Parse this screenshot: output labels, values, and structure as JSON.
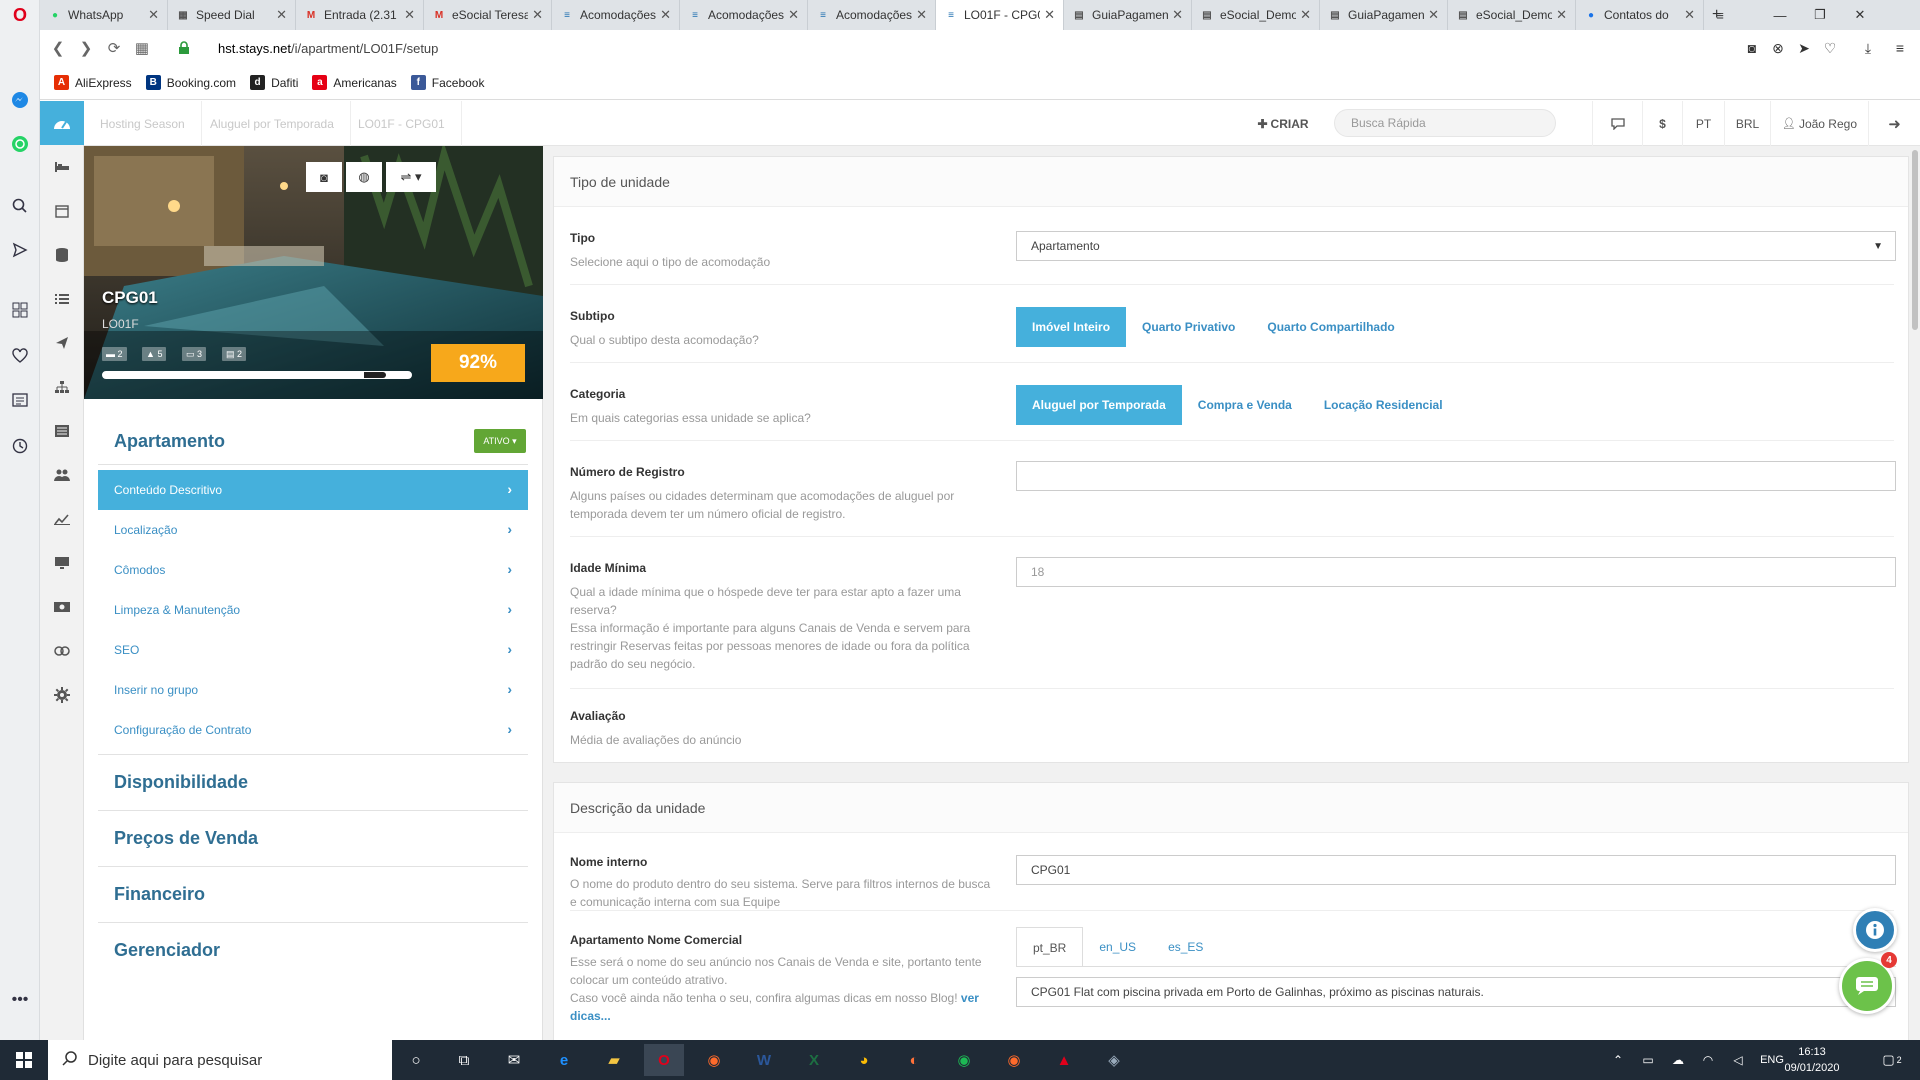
{
  "browser": {
    "tabs": [
      {
        "title": "WhatsApp",
        "fav": "whatsapp-icon",
        "color": "#25d366"
      },
      {
        "title": "Speed Dial",
        "fav": "grid-icon",
        "color": "#555555"
      },
      {
        "title": "Entrada (2.31",
        "fav": "gmail-icon",
        "color": "#d93025"
      },
      {
        "title": "eSocial Teresa",
        "fav": "gmail-icon",
        "color": "#d93025"
      },
      {
        "title": "Acomodações",
        "fav": "stays-icon",
        "color": "#1f6fb0"
      },
      {
        "title": "Acomodações",
        "fav": "stays-icon",
        "color": "#1f6fb0"
      },
      {
        "title": "Acomodações",
        "fav": "stays-icon",
        "color": "#1f6fb0"
      },
      {
        "title": "LO01F - CPG0",
        "fav": "stays-icon",
        "color": "#1f6fb0"
      },
      {
        "title": "GuiaPagamen",
        "fav": "doc-icon",
        "color": "#555555"
      },
      {
        "title": "eSocial_Demo",
        "fav": "doc-icon",
        "color": "#555555"
      },
      {
        "title": "GuiaPagamen",
        "fav": "doc-icon",
        "color": "#555555"
      },
      {
        "title": "eSocial_Demo",
        "fav": "doc-icon",
        "color": "#555555"
      },
      {
        "title": "Contatos do",
        "fav": "contacts-icon",
        "color": "#1a73e8"
      }
    ],
    "active_tab_index": 7,
    "url_host": "hst.stays.net",
    "url_path": "/i/apartment/LO01F/setup",
    "bookmarks": [
      {
        "label": "AliExpress",
        "icon": "aliexpress-icon",
        "color": "#e62e04",
        "glyph": "A"
      },
      {
        "label": "Booking.com",
        "icon": "booking-icon",
        "color": "#003580",
        "glyph": "B"
      },
      {
        "label": "Dafiti",
        "icon": "dafiti-icon",
        "color": "#222222",
        "glyph": "d"
      },
      {
        "label": "Americanas",
        "icon": "americanas-icon",
        "color": "#e60014",
        "glyph": "a"
      },
      {
        "label": "Facebook",
        "icon": "facebook-icon",
        "color": "#3b5998",
        "glyph": "f"
      }
    ]
  },
  "header": {
    "breadcrumbs": [
      "Hosting Season",
      "Aluguel por Temporada",
      "LO01F - CPG01"
    ],
    "create_label": "CRIAR",
    "search_placeholder": "Busca Rápida",
    "currency_symbol": "$",
    "language": "PT",
    "currency": "BRL",
    "user": "João Rego"
  },
  "property": {
    "title": "CPG01",
    "code": "LO01F",
    "badges": [
      "2",
      "5",
      "3",
      "2"
    ],
    "completion": 92,
    "completion_label": "92%",
    "section_title": "Apartamento",
    "status": "ATIVO",
    "menu": [
      "Conteúdo Descritivo",
      "Localização",
      "Cômodos",
      "Limpeza & Manutenção",
      "SEO",
      "Inserir no grupo",
      "Configuração de Contrato"
    ],
    "active_menu": 0,
    "sections": [
      "Disponibilidade",
      "Preços de Venda",
      "Financeiro",
      "Gerenciador"
    ]
  },
  "unit_type": {
    "title": "Tipo de unidade",
    "tipo": {
      "label": "Tipo",
      "desc": "Selecione aqui o tipo de acomodação",
      "value": "Apartamento"
    },
    "subtipo": {
      "label": "Subtipo",
      "desc": "Qual o subtipo desta acomodação?",
      "options": [
        "Imóvel Inteiro",
        "Quarto Privativo",
        "Quarto Compartilhado"
      ],
      "selected": 0
    },
    "categoria": {
      "label": "Categoria",
      "desc": "Em quais categorias essa unidade se aplica?",
      "options": [
        "Aluguel por Temporada",
        "Compra e Venda",
        "Locação Residencial"
      ],
      "selected": 0
    },
    "registro": {
      "label": "Número de Registro",
      "desc": "Alguns países ou cidades determinam que acomodações de aluguel por temporada devem ter um número oficial de registro.",
      "value": ""
    },
    "idade": {
      "label": "Idade Mínima",
      "desc1": "Qual a idade mínima que o hóspede deve ter para estar apto a fazer uma reserva?",
      "desc2": "Essa informação é importante para alguns Canais de Venda e servem para restringir Reservas feitas por pessoas menores de idade ou fora da política padrão do seu negócio.",
      "value": "18"
    },
    "avaliacao": {
      "label": "Avaliação",
      "desc": "Média de avaliações do anúncio"
    }
  },
  "unit_desc": {
    "title": "Descrição da unidade",
    "nome_interno": {
      "label": "Nome interno",
      "desc": "O nome do produto dentro do seu sistema. Serve para filtros internos de busca e comunicação interna com sua Equipe",
      "value": "CPG01"
    },
    "nome_comercial": {
      "label": "Apartamento Nome Comercial",
      "desc1": "Esse será o nome do seu anúncio nos Canais de Venda e site, portanto tente colocar um conteúdo atrativo.",
      "desc2": "Caso você ainda não tenha o seu, confira algumas dicas em nosso Blog!",
      "link": "ver dicas...",
      "langs": [
        "pt_BR",
        "en_US",
        "es_ES"
      ],
      "selected": 0,
      "value": "CPG01 Flat com piscina privada em Porto de Galinhas, próximo as piscinas naturais."
    }
  },
  "chat": {
    "badge": "4"
  },
  "taskbar": {
    "search_placeholder": "Digite aqui para pesquisar",
    "lang": "ENG",
    "time": "16:13",
    "date": "09/01/2020",
    "notif_count": "2"
  },
  "colors": {
    "accent": "#45b0dc",
    "link": "#3a8fc4",
    "heading": "#2f6e92",
    "active_badge": "#62a635",
    "progress": "#f7a81b"
  }
}
